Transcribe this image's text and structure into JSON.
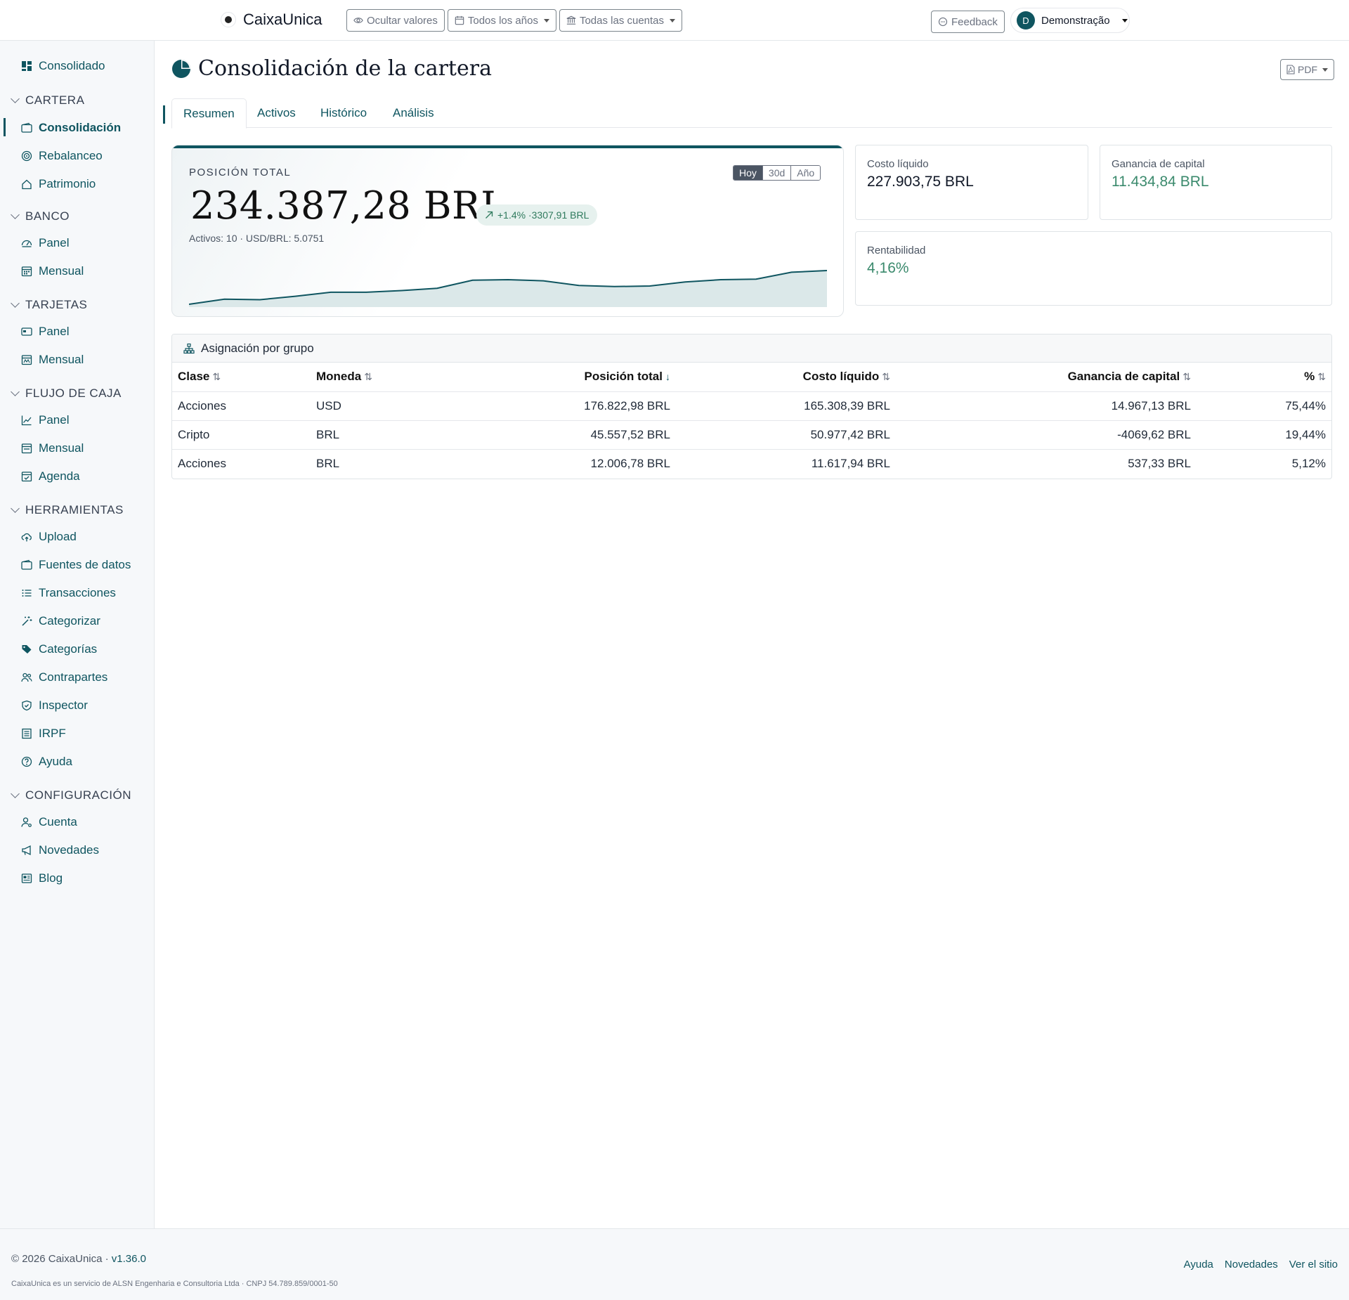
{
  "brand": {
    "name": "CaixaUnica"
  },
  "toolbar": {
    "hide_values": "Ocultar valores",
    "years": "Todos los años",
    "accounts": "Todas las cuentas",
    "feedback": "Feedback",
    "user_initial": "D",
    "user_name": "Demonstração"
  },
  "sidebar": {
    "top_item": "Consolidado",
    "sections": {
      "cartera": "CARTERA",
      "banco": "BANCO",
      "tarjetas": "TARJETAS",
      "flujo": "FLUJO DE CAJA",
      "herramientas": "HERRAMIENTAS",
      "config": "CONFIGURACIÓN"
    },
    "items": {
      "consolidacion": "Consolidación",
      "rebalanceo": "Rebalanceo",
      "patrimonio": "Patrimonio",
      "banco_panel": "Panel",
      "banco_mensual": "Mensual",
      "tarjetas_panel": "Panel",
      "tarjetas_mensual": "Mensual",
      "flujo_panel": "Panel",
      "flujo_mensual": "Mensual",
      "agenda": "Agenda",
      "upload": "Upload",
      "fuentes": "Fuentes de datos",
      "transacciones": "Transacciones",
      "categorizar": "Categorizar",
      "categorias": "Categorías",
      "contrapartes": "Contrapartes",
      "inspector": "Inspector",
      "irpf": "IRPF",
      "ayuda": "Ayuda",
      "cuenta": "Cuenta",
      "novedades": "Novedades",
      "blog": "Blog"
    }
  },
  "page": {
    "title": "Consolidación de la cartera",
    "pdf": "PDF",
    "tabs": [
      "Resumen",
      "Activos",
      "Histórico",
      "Análisis"
    ]
  },
  "hero": {
    "label": "POSICIÓN TOTAL",
    "value": "234.387,28 BRL",
    "delta": "+1.4% ·3307,91 BRL",
    "sub": "Activos: 10 · USD/BRL: 5.0751",
    "ranges": [
      "Hoy",
      "30d",
      "Año"
    ],
    "active_range": "Hoy",
    "sparkline": [
      0.0,
      0.18,
      0.16,
      0.28,
      0.42,
      0.42,
      0.48,
      0.56,
      0.84,
      0.86,
      0.82,
      0.66,
      0.62,
      0.64,
      0.78,
      0.86,
      0.88,
      1.12,
      1.18
    ]
  },
  "stats": {
    "costo": {
      "label": "Costo líquido",
      "value": "227.903,75 BRL"
    },
    "ganancia": {
      "label": "Ganancia de capital",
      "value": "11.434,84 BRL"
    },
    "rentabilidad": {
      "label": "Rentabilidad",
      "value": "4,16%"
    }
  },
  "allocation": {
    "title": "Asignación por grupo",
    "columns": [
      "Clase",
      "Moneda",
      "Posición total",
      "Costo líquido",
      "Ganancia de capital",
      "%"
    ],
    "rows": [
      [
        "Acciones",
        "USD",
        "176.822,98 BRL",
        "165.308,39 BRL",
        "14.967,13 BRL",
        "75,44%"
      ],
      [
        "Cripto",
        "BRL",
        "45.557,52 BRL",
        "50.977,42 BRL",
        "-4069,62 BRL",
        "19,44%"
      ],
      [
        "Acciones",
        "BRL",
        "12.006,78 BRL",
        "11.617,94 BRL",
        "537,33 BRL",
        "5,12%"
      ]
    ]
  },
  "footer": {
    "copyright": "© 2026 CaixaUnica · ",
    "version": "v1.36.0",
    "legal": "CaixaUnica es un servicio de ALSN Engenharia e Consultoria Ltda · CNPJ 54.789.859/0001-50",
    "links": [
      "Ayuda",
      "Novedades",
      "Ver el sitio"
    ]
  },
  "colors": {
    "accent": "#0f5560",
    "positive": "#3b8a6d",
    "sidebar_bg": "#f6f8fa"
  }
}
